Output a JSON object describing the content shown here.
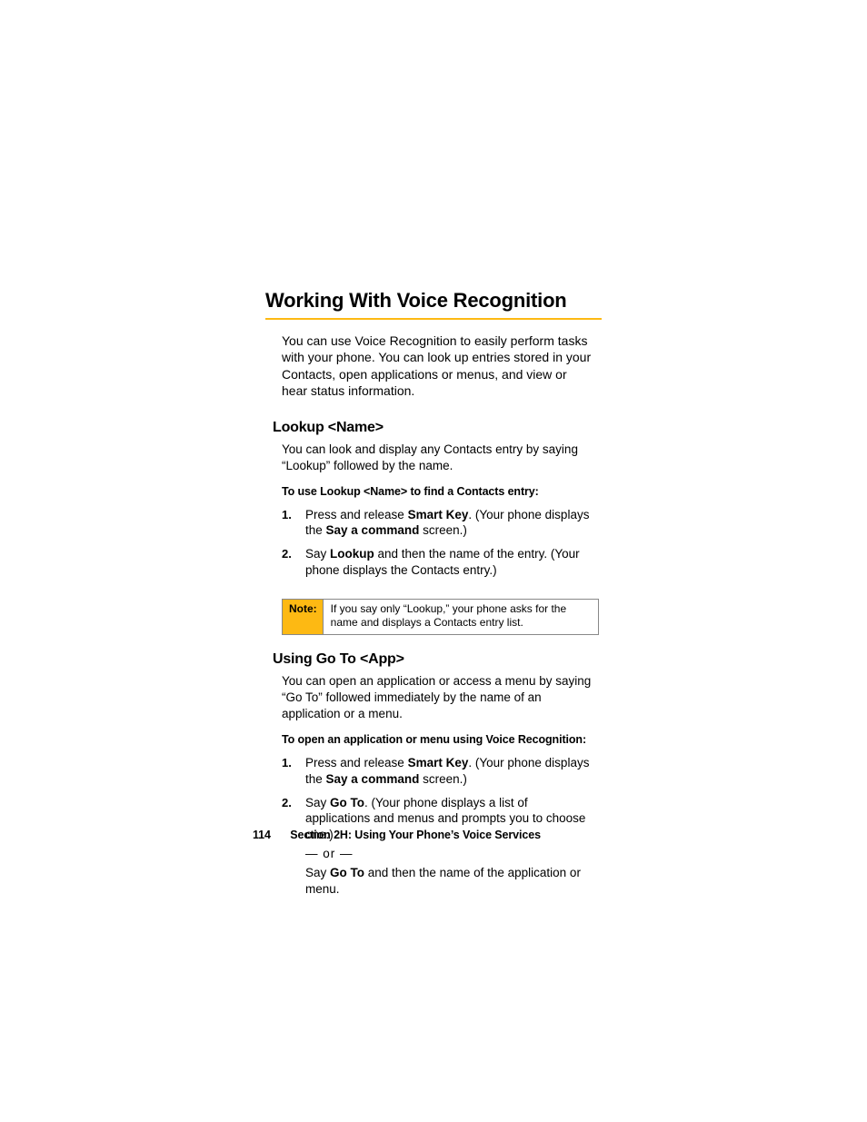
{
  "heading": "Working With Voice Recognition",
  "intro": "You can use Voice Recognition to easily perform tasks with your phone. You can look up entries stored in your Contacts, open applications or menus, and view or hear status information.",
  "section1": {
    "title": "Lookup <Name>",
    "para": "You can look and display any Contacts entry by saying “Lookup” followed by the name.",
    "lead": "To use Lookup <Name> to find a Contacts entry:",
    "step1": {
      "pre": "Press and release ",
      "bold": "Smart Key",
      "post": ". (Your phone displays the ",
      "bold2": "Say a command",
      "post2": " screen.)"
    },
    "step2": {
      "pre": "Say ",
      "bold": "Lookup",
      "post": " and then the name of the entry. (Your phone displays the Contacts entry.)"
    },
    "note_label": "Note:",
    "note_body": "If you say only “Lookup,” your phone asks for the name and displays a Contacts entry list."
  },
  "section2": {
    "title": "Using Go To <App>",
    "para": "You can open an application or access a menu by saying “Go To” followed immediately by the name of an application or a menu.",
    "lead": "To open an application or menu using Voice Recognition:",
    "step1": {
      "pre": "Press and release ",
      "bold": "Smart Key",
      "post": ". (Your phone displays the ",
      "bold2": "Say a command",
      "post2": " screen.)"
    },
    "step2": {
      "preA": "Say ",
      "boldA": "Go To",
      "postA": ". (Your phone displays a list of applications and menus and prompts you to choose one.)",
      "or": "— or —",
      "preB": "Say ",
      "boldB": "Go To",
      "postB": " and then the name of the application or menu."
    }
  },
  "footer": {
    "page": "114",
    "caption": "Section 2H: Using Your Phone’s Voice Services"
  }
}
